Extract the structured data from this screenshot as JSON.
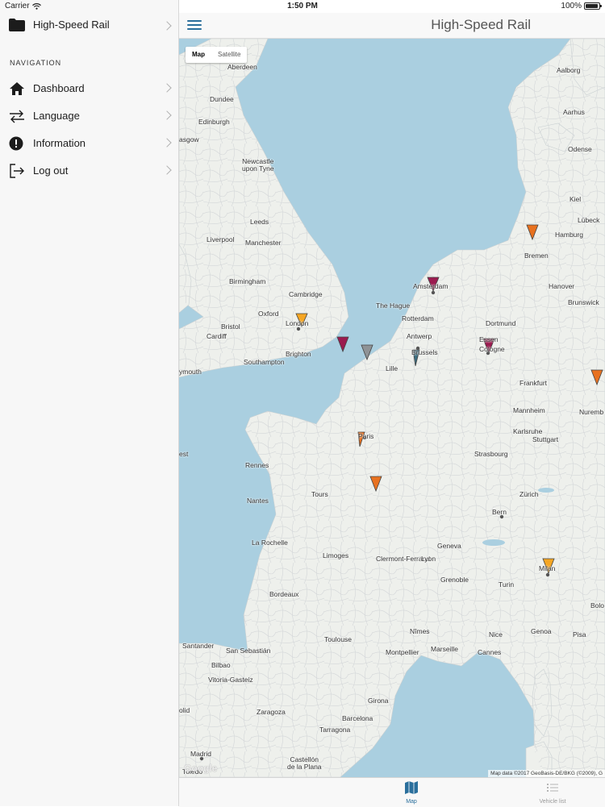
{
  "status_bar": {
    "carrier": "Carrier",
    "time": "1:50 PM",
    "battery": "100%"
  },
  "sidebar": {
    "header_title": "High-Speed Rail",
    "section_label": "NAVIGATION",
    "items": [
      {
        "label": "Dashboard",
        "icon": "home-icon"
      },
      {
        "label": "Language",
        "icon": "swap-arrows-icon"
      },
      {
        "label": "Information",
        "icon": "info-circle-icon"
      },
      {
        "label": "Log out",
        "icon": "logout-icon"
      }
    ]
  },
  "header": {
    "title": "High-Speed Rail"
  },
  "map": {
    "map_type": {
      "active": "Map",
      "inactive": "Satellite"
    },
    "attribution": "Map data ©2017 GeoBasis-DE/BKG (©2009), G",
    "watermark": "Google",
    "cities": [
      "Aberdeen",
      "Dundee",
      "Edinburgh",
      "Glasgow",
      "Newcastle upon Tyne",
      "Leeds",
      "Liverpool",
      "Manchester",
      "Birmingham",
      "Cambridge",
      "Oxford",
      "London",
      "Bristol",
      "Cardiff",
      "Brighton",
      "Southampton",
      "Plymouth",
      "Amsterdam",
      "The Hague",
      "Rotterdam",
      "Antwerp",
      "Brussels",
      "Lille",
      "Dortmund",
      "Essen",
      "Cologne",
      "Hamburg",
      "Bremen",
      "Hanover",
      "Brunswick",
      "Kiel",
      "Lübeck",
      "Aalborg",
      "Aarhus",
      "Odense",
      "Frankfurt",
      "Mannheim",
      "Karlsruhe",
      "Stuttgart",
      "Nuremberg",
      "Strasbourg",
      "Paris",
      "Rennes",
      "Brest",
      "Nantes",
      "Tours",
      "Zürich",
      "Bern",
      "Geneva",
      "La Rochelle",
      "Limoges",
      "Clermont-Ferrand",
      "Lyon",
      "Grenoble",
      "Turin",
      "Milan",
      "Genoa",
      "Bologna",
      "Pisa",
      "Nice",
      "Cannes",
      "Marseille",
      "Montpellier",
      "Nîmes",
      "Toulouse",
      "Bordeaux",
      "Santander",
      "San Sebastián",
      "Bilbao",
      "Vitoria-Gasteiz",
      "Zaragoza",
      "Girona",
      "Barcelona",
      "Tarragona",
      "Oviedo",
      "Madrid",
      "Toledo",
      "Castellón de la Plana"
    ],
    "city_labels_multiline": {
      "Newcastle upon Tyne": [
        "Newcastle",
        "upon Tyne"
      ],
      "Castellón de la Plana": [
        "Castellón",
        "de la Plana"
      ]
    },
    "city_labels_cropped": {
      "Glasgow": "asgow",
      "Plymouth": "ymouth",
      "Brest": "est",
      "Nuremberg": "Nuremb",
      "Oviedo": "olid",
      "Bologna": "Bolo"
    },
    "markers": [
      {
        "color": "#f5a623",
        "name": "London"
      },
      {
        "color": "#9b1b4f",
        "name": "English Channel"
      },
      {
        "color": "#8f9396",
        "name": "Calais"
      },
      {
        "color": "#9b1b4f",
        "name": "Amsterdam"
      },
      {
        "color": "#9b1b4f",
        "name": "Cologne"
      },
      {
        "color": "#3c6e80",
        "name": "Brussels"
      },
      {
        "color": "#e8711f",
        "name": "Hamburg"
      },
      {
        "color": "#e8711f",
        "name": "East of Frankfurt"
      },
      {
        "color": "#e8711f",
        "name": "Paris"
      },
      {
        "color": "#e8711f",
        "name": "South of Paris"
      },
      {
        "color": "#f5a623",
        "name": "Milan"
      }
    ]
  },
  "tab_bar": {
    "tabs": [
      {
        "label": "Map",
        "icon": "map-icon",
        "active": true,
        "color": "#2a6f9c"
      },
      {
        "label": "Vehicle list",
        "icon": "list-icon",
        "active": false,
        "color": "#9a9a9a"
      }
    ]
  },
  "colors": {
    "sea": "#aacfe0",
    "land": "#eef0ec",
    "accent": "#2a6f9c"
  }
}
